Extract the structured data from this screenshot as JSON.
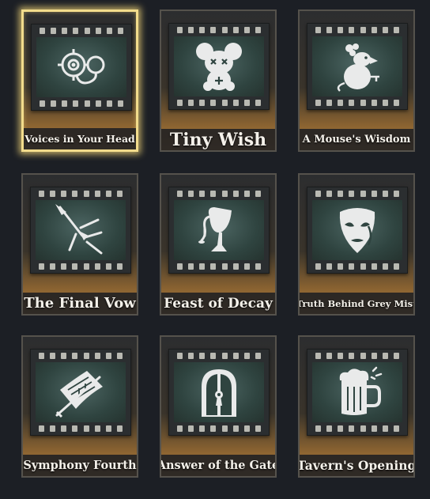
{
  "memories": [
    {
      "title": "Voices in Your Head",
      "icon": "monocle-device-icon",
      "selected": true
    },
    {
      "title": "Tiny Wish",
      "icon": "plush-mouse-icon",
      "selected": false
    },
    {
      "title": "A Mouse's Wisdom",
      "icon": "mouse-with-key-icon",
      "selected": false
    },
    {
      "title": "The Final Vow",
      "icon": "broken-spear-icon",
      "selected": false
    },
    {
      "title": "Feast of Decay",
      "icon": "spilled-goblet-icon",
      "selected": false
    },
    {
      "title": "Truth Behind Grey Mist",
      "icon": "weeping-mask-icon",
      "selected": false
    },
    {
      "title": "Symphony Fourth",
      "icon": "sheet-music-bow-icon",
      "selected": false
    },
    {
      "title": "Answer of the Gate",
      "icon": "arched-gate-icon",
      "selected": false
    },
    {
      "title": "Tavern's Opening",
      "icon": "beer-mug-icon",
      "selected": false
    }
  ],
  "colors": {
    "background": "#1c1f25",
    "selection_glow": "#f2dc8c",
    "card_gold": "#b07c3a",
    "film_frame": "#2f4440"
  }
}
